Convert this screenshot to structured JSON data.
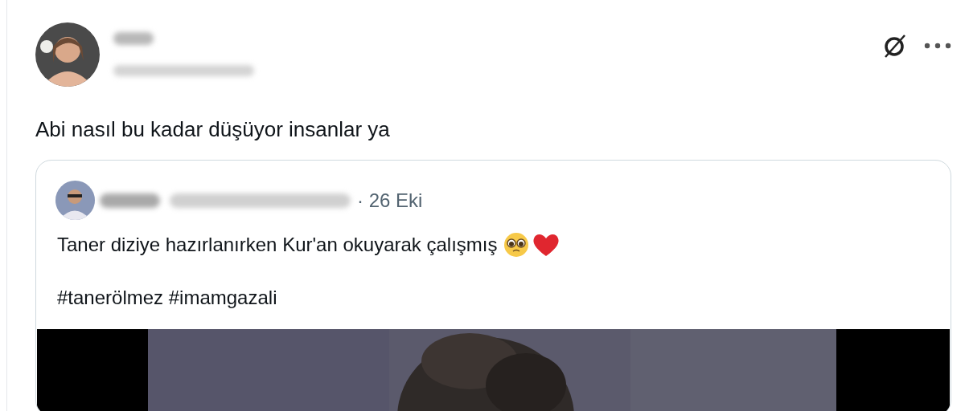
{
  "post": {
    "text": "Abi nasıl bu kadar düşüyor insanlar ya"
  },
  "quote": {
    "date": "· 26 Eki",
    "lines": [
      "Taner diziye hazırlanırken Kur'an okuyarak çalışmış",
      "#tanerölmez #imamgazali"
    ],
    "emojis": [
      {
        "kind": "pleading-face"
      },
      {
        "kind": "heart"
      }
    ]
  }
}
